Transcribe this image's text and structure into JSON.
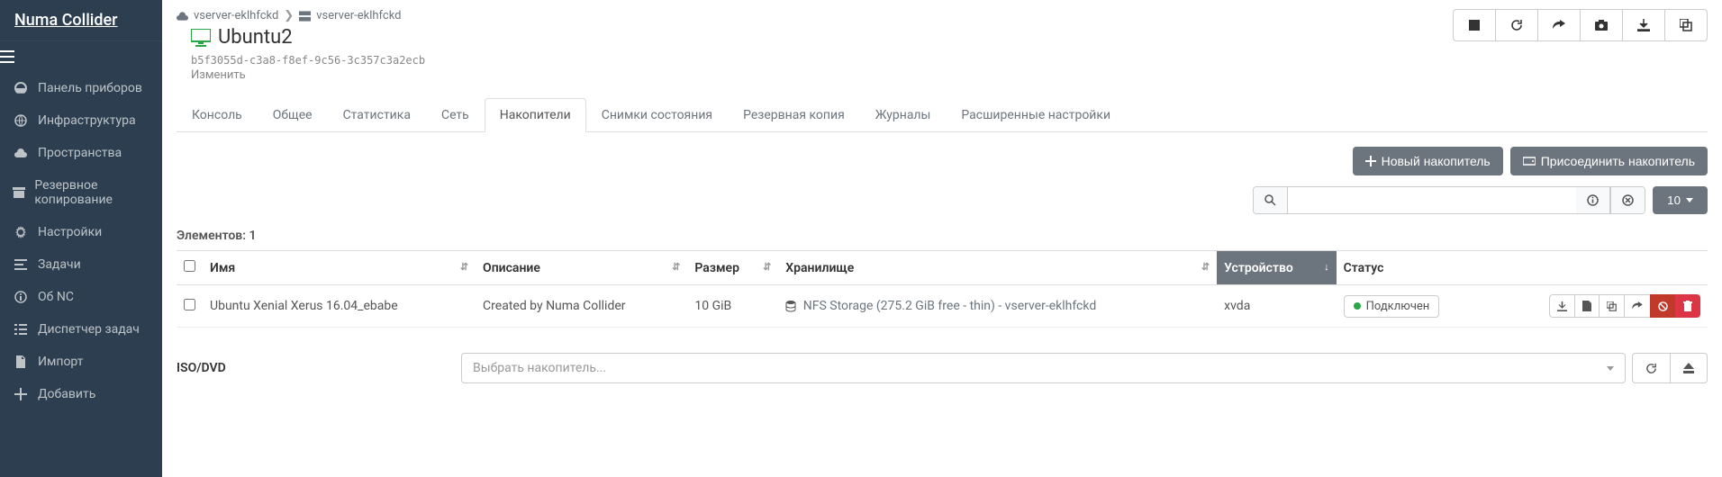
{
  "brand": "Numa Collider",
  "sidebar": {
    "items": [
      {
        "label": "Панель приборов",
        "icon": "dashboard"
      },
      {
        "label": "Инфраструктура",
        "icon": "globe"
      },
      {
        "label": "Пространства",
        "icon": "cloud"
      },
      {
        "label": "Резервное копирование",
        "icon": "archive"
      },
      {
        "label": "Настройки",
        "icon": "gear"
      },
      {
        "label": "Задачи",
        "icon": "tasks"
      },
      {
        "label": "Об NC",
        "icon": "info"
      },
      {
        "label": "Диспетчер задач",
        "icon": "list"
      },
      {
        "label": "Импорт",
        "icon": "import"
      },
      {
        "label": "Добавить",
        "icon": "plus"
      }
    ]
  },
  "breadcrumb": {
    "host": "vserver-eklhfckd",
    "vm": "vserver-eklhfckd"
  },
  "vm": {
    "name": "Ubuntu2",
    "uuid": "b5f3055d-c3a8-f8ef-9c56-3c357c3a2ecb",
    "edit": "Изменить"
  },
  "tabs": {
    "console": "Консоль",
    "general": "Общее",
    "stats": "Статистика",
    "network": "Сеть",
    "storage": "Накопители",
    "snapshots": "Снимки состояния",
    "backup": "Резервная копия",
    "logs": "Журналы",
    "advanced": "Расширенные настройки"
  },
  "toolbar": {
    "new_disk": "Новый накопитель",
    "attach_disk": "Присоединить накопитель"
  },
  "pagesize": "10",
  "elements_label": "Элементов: 1",
  "columns": {
    "name": "Имя",
    "desc": "Описание",
    "size": "Размер",
    "storage": "Хранилище",
    "device": "Устройство",
    "status": "Статус"
  },
  "rows": [
    {
      "name": "Ubuntu Xenial Xerus 16.04_ebabe",
      "desc": "Created by Numa Collider",
      "size": "10 GiB",
      "storage": "NFS Storage (275.2 GiB free - thin) - vserver-eklhfckd",
      "device": "xvda",
      "status": "Подключен"
    }
  ],
  "iso": {
    "label": "ISO/DVD",
    "placeholder": "Выбрать накопитель..."
  }
}
